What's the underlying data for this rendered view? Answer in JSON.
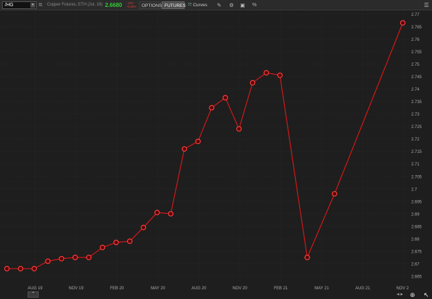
{
  "toolbar": {
    "symbol": "/HG",
    "symbol_dropdown": "▾",
    "description": "Copper Futures, ETH (Jul, 19)",
    "last_price": "2.6680",
    "net_change": "-.007",
    "pct_change": "-0.26%",
    "options_label": "OPTIONS",
    "futures_label": "FUTURES",
    "curves_label": "Curves",
    "percent_label": "%",
    "icons": [
      "link-icon",
      "curves-icon",
      "drawing-icon",
      "style-icon",
      "snapshot-icon",
      "percent-icon",
      "menu-icon"
    ]
  },
  "bottom": {
    "collapse_label": "⌃"
  },
  "colors": {
    "line": "#d81818",
    "marker_fill": "#5a0000",
    "marker_stroke": "#ff4040",
    "grid": "#333333",
    "price_up": "#33cc33",
    "price_down": "#e53a3a"
  },
  "chart_data": {
    "type": "line",
    "title": "",
    "xlabel": "",
    "ylabel": "",
    "x_ticks": [
      "AUG 19",
      "NOV 19",
      "FEB 20",
      "MAY 20",
      "AUG 20",
      "NOV 20",
      "FEB 21",
      "MAY 21",
      "AUG 21",
      "NOV 21"
    ],
    "y_ticks": [
      "2.665",
      "2.67",
      "2.675",
      "2.68",
      "2.685",
      "2.69",
      "2.695",
      "2.7",
      "2.705",
      "2.71",
      "2.715",
      "2.72",
      "2.725",
      "2.73",
      "2.735",
      "2.74",
      "2.745",
      "2.75",
      "2.755",
      "2.76",
      "2.765",
      "2.77"
    ],
    "ylim": [
      2.6625,
      2.7715
    ],
    "grid": true,
    "series": [
      {
        "x": [
          "2019-07",
          "2019-08",
          "2019-09",
          "2019-10",
          "2019-11",
          "2019-12",
          "2020-01",
          "2020-02",
          "2020-03",
          "2020-04",
          "2020-05",
          "2020-06",
          "2020-07",
          "2020-08",
          "2020-09",
          "2020-10",
          "2020-11",
          "2020-12",
          "2021-01",
          "2021-02",
          "2021-03",
          "2021-05",
          "2021-07",
          "2021-12"
        ],
        "values": [
          2.668,
          2.668,
          2.668,
          2.671,
          2.672,
          2.6725,
          2.6725,
          2.6765,
          2.6785,
          2.679,
          2.6845,
          2.6905,
          2.69,
          2.716,
          2.719,
          2.7325,
          2.7365,
          2.724,
          2.7425,
          2.7465,
          2.7455,
          2.6725,
          2.698,
          2.7665
        ]
      }
    ]
  }
}
